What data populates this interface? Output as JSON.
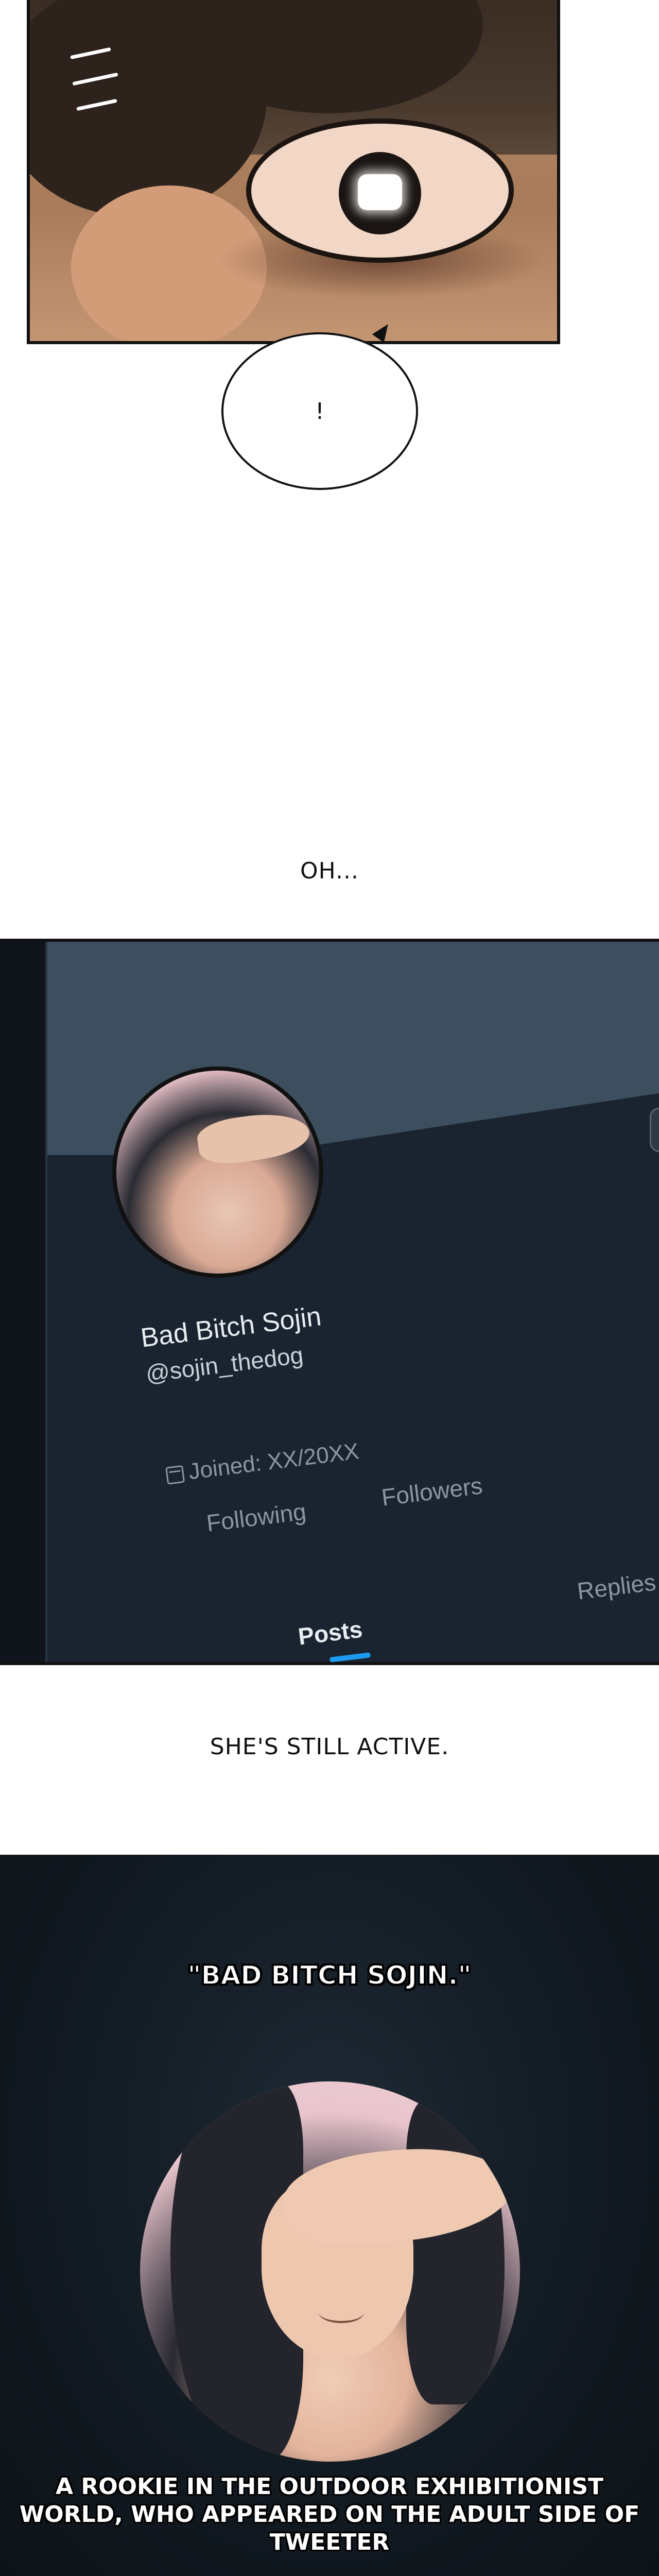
{
  "panel1": {
    "bubble_text": "!"
  },
  "narration": {
    "oh": "OH...",
    "still_active": "SHE'S STILL ACTIVE."
  },
  "profile": {
    "display_name": "Bad Bitch Sojin",
    "handle": "@sojin_thedog",
    "joined": "Joined: XX/20XX",
    "following_label": "Following",
    "followers_label": "Followers",
    "tabs": [
      "Posts",
      "Replies"
    ],
    "accent_color": "#1d9bf0"
  },
  "panel3": {
    "title": "\"BAD BITCH SOJIN.\"",
    "caption": "A ROOKIE IN THE OUTDOOR EXHIBITIONIST WORLD, WHO APPEARED ON THE ADULT SIDE OF TWEETER"
  }
}
